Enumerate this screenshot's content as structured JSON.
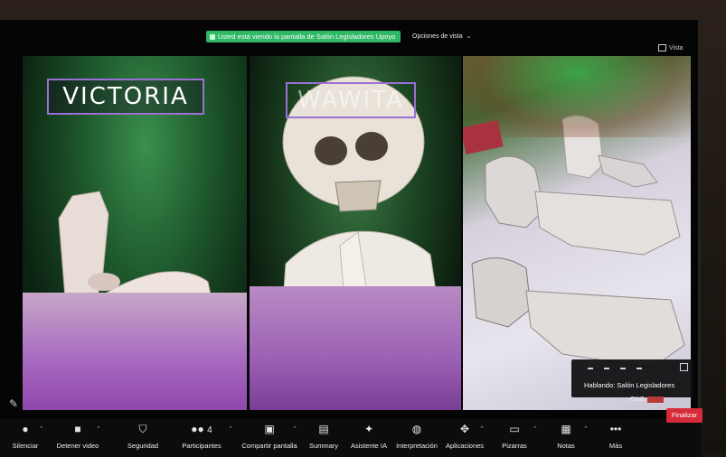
{
  "share": {
    "banner_text": "Usted está viendo la pantalla de Salón Legisladores Upoyo",
    "view_options_label": "Opciones de vista",
    "view_options_chevron": "chevron-down-icon",
    "view_button_label": "Vista",
    "accent_color": "#2fb865"
  },
  "panels": {
    "left_label": "VICTORIA",
    "middle_label": "WAWITA"
  },
  "speaker": {
    "speaking_text": "Hablando: Salón Legisladores",
    "participant_tag": "ONG"
  },
  "toolbar": {
    "items": [
      {
        "label": "Silenciar",
        "icon": "microphone-icon"
      },
      {
        "label": "Detener video",
        "icon": "video-camera-icon"
      },
      {
        "label": "Seguridad",
        "icon": "shield-icon"
      },
      {
        "label": "Participantes",
        "icon": "people-icon",
        "count": "4"
      },
      {
        "label": "Compartir pantalla",
        "icon": "share-screen-icon"
      },
      {
        "label": "Summary",
        "icon": "document-icon"
      },
      {
        "label": "Asistente IA",
        "icon": "sparkle-icon"
      },
      {
        "label": "Interpretación",
        "icon": "globe-icon"
      },
      {
        "label": "Aplicaciones",
        "icon": "apps-icon"
      },
      {
        "label": "Pizarras",
        "icon": "whiteboard-icon"
      },
      {
        "label": "Notas",
        "icon": "notes-icon"
      },
      {
        "label": "Más",
        "icon": "more-icon"
      }
    ],
    "end_button": "Finalizar",
    "end_color": "#d62b3a"
  }
}
